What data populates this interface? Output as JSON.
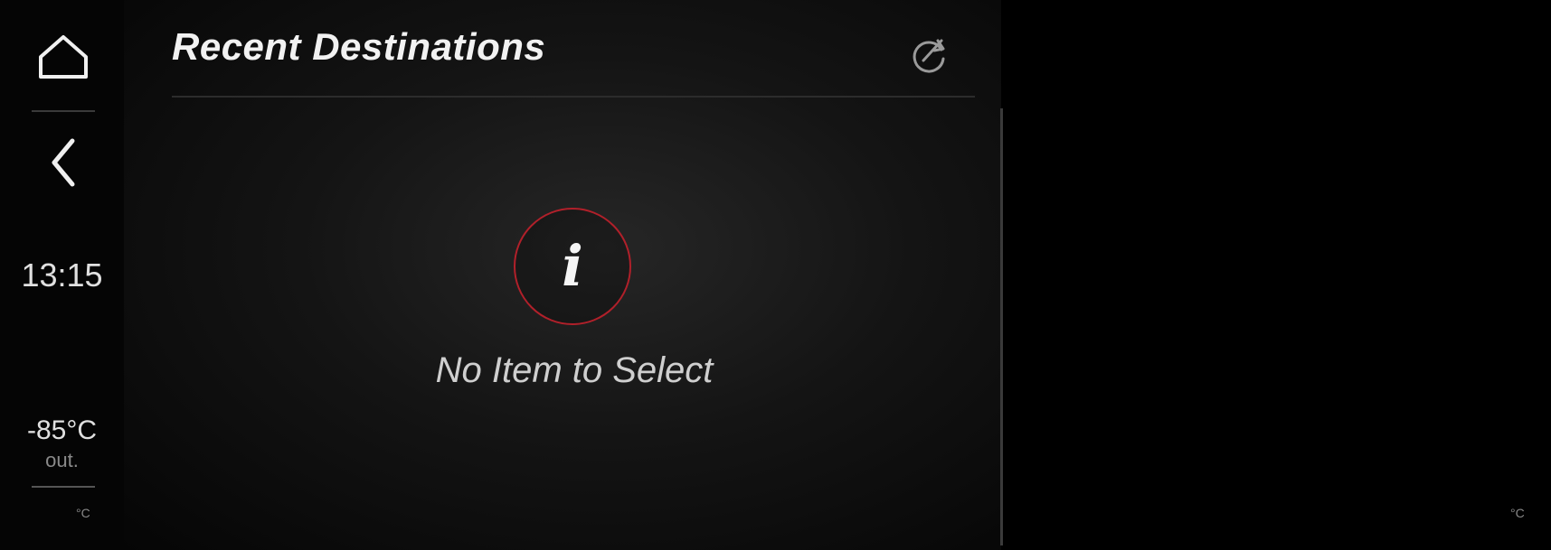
{
  "header": {
    "title": "Recent Destinations"
  },
  "status": {
    "time": "13:15",
    "outside_temp": "-85°C",
    "outside_label": "out.",
    "left_unit": "°C",
    "right_unit": "°C"
  },
  "content": {
    "empty_message": "No Item to Select"
  },
  "icons": {
    "home": "home-icon",
    "back": "back-icon",
    "refresh": "refresh-icon",
    "info": "info-icon"
  },
  "colors": {
    "accent_red": "#b1202a",
    "background": "#000000"
  }
}
